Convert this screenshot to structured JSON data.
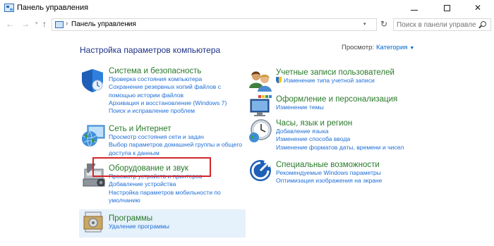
{
  "window": {
    "title": "Панель управления",
    "minimize": "–",
    "close": "✕"
  },
  "nav": {
    "back": "←",
    "forward": "→",
    "history_dropdown": "▾",
    "up": "↑",
    "address_separator": "›",
    "address_text": "Панель управления",
    "address_dropdown": "▾",
    "refresh": "↻",
    "search_placeholder": "Поиск в панели управления"
  },
  "page_title": "Настройка параметров компьютера",
  "view": {
    "label": "Просмотр:",
    "value": "Категория",
    "caret": "▼"
  },
  "categories": {
    "security": {
      "title": "Система и безопасность",
      "links": [
        "Проверка состояния компьютера",
        "Сохранение резервных копий файлов с",
        "помощью истории файлов",
        "Архивация и восстановление (Windows 7)",
        "Поиск и исправление проблем"
      ]
    },
    "network": {
      "title": "Сеть и Интернет",
      "links": [
        "Просмотр состояния сети и задач",
        "Выбор параметров домашней группы и общего",
        "доступа к данным"
      ]
    },
    "hardware": {
      "title": "Оборудование и звук",
      "links": [
        "Просмотр устройств и принтеров",
        "Добавление устройства",
        "Настройка параметров мобильности по",
        "умолчанию"
      ]
    },
    "programs": {
      "title": "Программы",
      "links": [
        "Удаление программы"
      ]
    },
    "accounts": {
      "title": "Учетные записи пользователей",
      "links": [
        "Изменение типа учетной записи"
      ]
    },
    "appearance": {
      "title": "Оформление и персонализация",
      "links": [
        "Изменение темы"
      ]
    },
    "clock": {
      "title": "Часы, язык и регион",
      "links": [
        "Добавление языка",
        "Изменение способа ввода",
        "Изменение форматов даты, времени и чисел"
      ]
    },
    "access": {
      "title": "Специальные возможности",
      "links": [
        "Рекомендуемые Windows параметры",
        "Оптимизация изображения на экране"
      ]
    }
  },
  "colors": {
    "title_blue": "#1e3287",
    "link_blue": "#1e6ed6",
    "category_blue": "#1e7bc8",
    "highlight_red": "#d3262b",
    "programs_bg": "#e5f1fb"
  }
}
